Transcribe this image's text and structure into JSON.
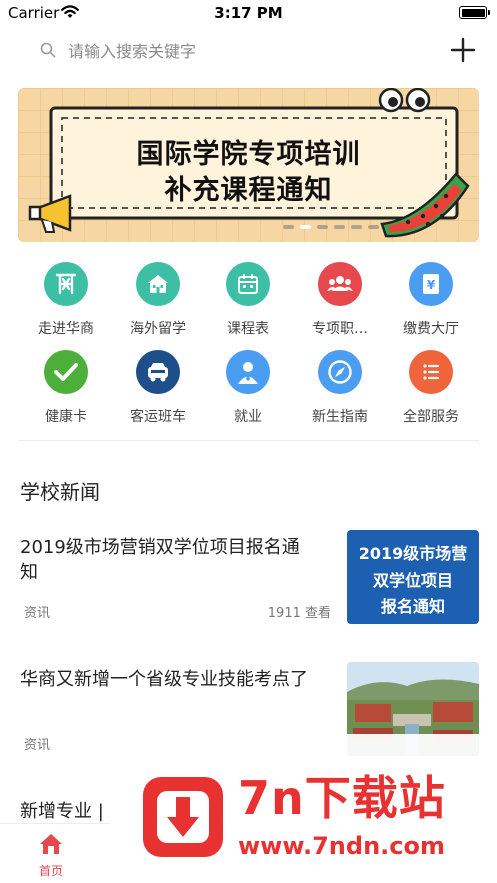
{
  "status_bar": {
    "carrier": "Carrier",
    "time": "3:17 PM"
  },
  "search": {
    "placeholder": "请输入搜索关键字"
  },
  "banner": {
    "title_line1": "国际学院专项培训",
    "title_line2": "补充课程通知",
    "pages": 6,
    "active_page": 1
  },
  "grid": [
    {
      "label": "走进华商",
      "icon": "campus-logo-icon",
      "color": "#3dbfa6"
    },
    {
      "label": "海外留学",
      "icon": "building-icon",
      "color": "#3dbfa6"
    },
    {
      "label": "课程表",
      "icon": "calendar-icon",
      "color": "#3dbfa6"
    },
    {
      "label": "专项职…",
      "icon": "group-icon",
      "color": "#e5484d"
    },
    {
      "label": "缴费大厅",
      "icon": "payment-icon",
      "color": "#4a9df0"
    },
    {
      "label": "健康卡",
      "icon": "check-icon",
      "color": "#4caf3a"
    },
    {
      "label": "客运班车",
      "icon": "bus-icon",
      "color": "#1f4f8a"
    },
    {
      "label": "就业",
      "icon": "person-icon",
      "color": "#4a9df0"
    },
    {
      "label": "新生指南",
      "icon": "compass-icon",
      "color": "#4a9df0"
    },
    {
      "label": "全部服务",
      "icon": "list-icon",
      "color": "#f0643c"
    }
  ],
  "news_section": {
    "title": "学校新闻"
  },
  "news": [
    {
      "title": "2019级市场营销双学位项目报名通知",
      "tag": "资讯",
      "views": "1911 查看",
      "thumb_text_1": "2019级市场营",
      "thumb_text_2": "双学位项目",
      "thumb_text_3": "报名通知"
    },
    {
      "title": "华商又新增一个省级专业技能考点了",
      "tag": "资讯",
      "views": ""
    },
    {
      "title": "新增专业 |",
      "tag": "",
      "views": ""
    }
  ],
  "tabbar": {
    "home_label": "首页"
  },
  "watermark": {
    "title": "7n下载站",
    "url": "www.7ndn.com"
  },
  "colors": {
    "accent": "#e5484d",
    "teal": "#3dbfa6",
    "blue": "#4a9df0",
    "banner_bg": "#f6d7a3"
  }
}
